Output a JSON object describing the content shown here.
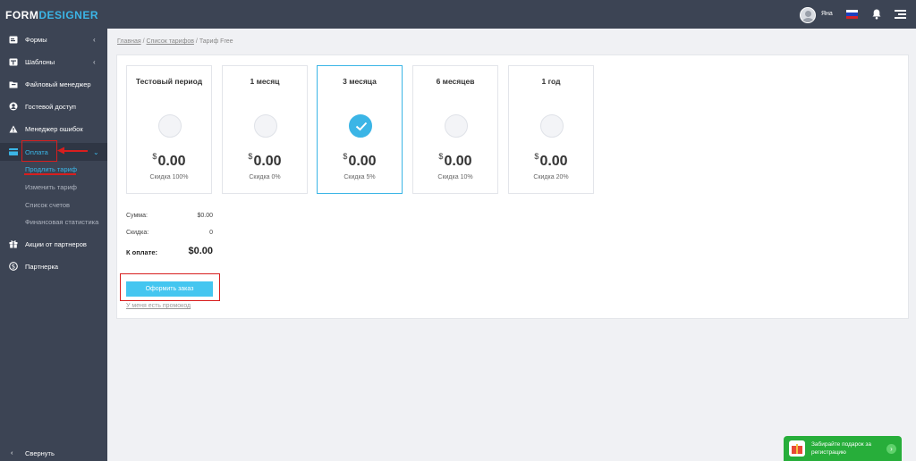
{
  "app": {
    "logo_part1": "FORM",
    "logo_part2": "DESIGNER",
    "accent_color": "#3bb5e6",
    "sidebar_color": "#3c4454"
  },
  "header": {
    "username": "Яна",
    "icons": [
      "avatar",
      "flag-ru-icon",
      "bell-icon",
      "menu-icon"
    ]
  },
  "sidebar": {
    "items": [
      {
        "label": "Формы",
        "icon": "forms-icon",
        "chevron": "‹"
      },
      {
        "label": "Шаблоны",
        "icon": "templates-icon",
        "chevron": "‹"
      },
      {
        "label": "Файловый менеджер",
        "icon": "folder-icon"
      },
      {
        "label": "Гостевой доступ",
        "icon": "user-circle-icon"
      },
      {
        "label": "Менеджер ошибок",
        "icon": "warning-icon"
      },
      {
        "label": "Оплата",
        "icon": "card-icon",
        "chevron": "⌄"
      },
      {
        "label": "Акции от партнеров",
        "icon": "gift-icon"
      },
      {
        "label": "Партнерка",
        "icon": "dollar-icon"
      }
    ],
    "payment_subitems": [
      {
        "label": "Продлить тариф"
      },
      {
        "label": "Изменить тариф"
      },
      {
        "label": "Список счетов"
      },
      {
        "label": "Финансовая статистика"
      }
    ],
    "collapse_label": "Свернуть",
    "collapse_icon": "‹"
  },
  "breadcrumb": {
    "home": "Главная",
    "tariffs": "Список тарифов",
    "separator": "/",
    "current": "Тариф Free"
  },
  "plans": [
    {
      "name": "Тестовый период",
      "currency": "$",
      "price": "0.00",
      "discount": "Скидка 100%",
      "selected": false
    },
    {
      "name": "1 месяц",
      "currency": "$",
      "price": "0.00",
      "discount": "Скидка 0%",
      "selected": false
    },
    {
      "name": "3 месяца",
      "currency": "$",
      "price": "0.00",
      "discount": "Скидка 5%",
      "selected": true
    },
    {
      "name": "6 месяцев",
      "currency": "$",
      "price": "0.00",
      "discount": "Скидка 10%",
      "selected": false
    },
    {
      "name": "1 год",
      "currency": "$",
      "price": "0.00",
      "discount": "Скидка 20%",
      "selected": false
    }
  ],
  "summary": {
    "sum_label": "Сумма:",
    "sum_value": "$0.00",
    "discount_label": "Скидка:",
    "discount_value": "0",
    "total_label": "К оплате:",
    "total_value": "$0.00"
  },
  "order_button_label": "Оформить заказ",
  "promo_link": "У меня есть промокод",
  "gift_banner": {
    "text": "Забирайте подарок за регистрацию",
    "arrow": "›",
    "color": "#27ae3a"
  }
}
